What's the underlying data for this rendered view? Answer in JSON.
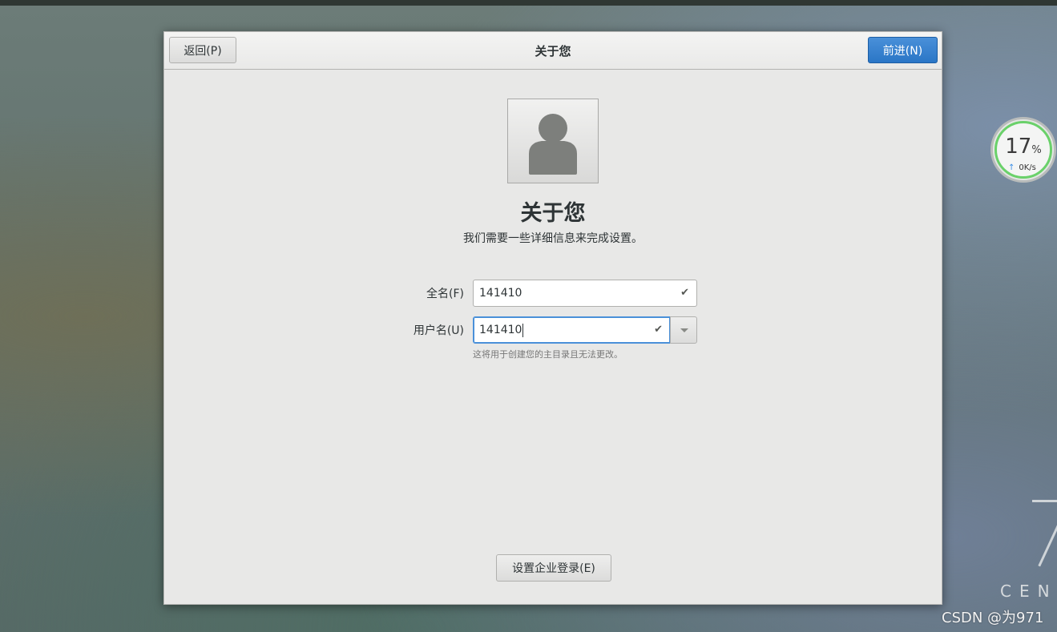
{
  "header": {
    "back_label": "返回(P)",
    "title": "关于您",
    "next_label": "前进(N)"
  },
  "main": {
    "heading": "关于您",
    "subtitle": "我们需要一些详细信息来完成设置。",
    "avatar_icon": "user-avatar-icon",
    "fields": {
      "fullname_label": "全名(F)",
      "fullname_value": "141410",
      "username_label": "用户名(U)",
      "username_value": "141410",
      "username_hint": "这将用于创建您的主目录且无法更改。"
    },
    "enterprise_label": "设置企业登录(E)"
  },
  "widget": {
    "percent": "17",
    "percent_sign": "%",
    "speed": "0K/s",
    "ring_color": "#6ad16a"
  },
  "desktop": {
    "brand_text": "CEN",
    "watermark": "CSDN @为971"
  },
  "colors": {
    "accent": "#2a76c6",
    "valid_check": "#555753"
  }
}
